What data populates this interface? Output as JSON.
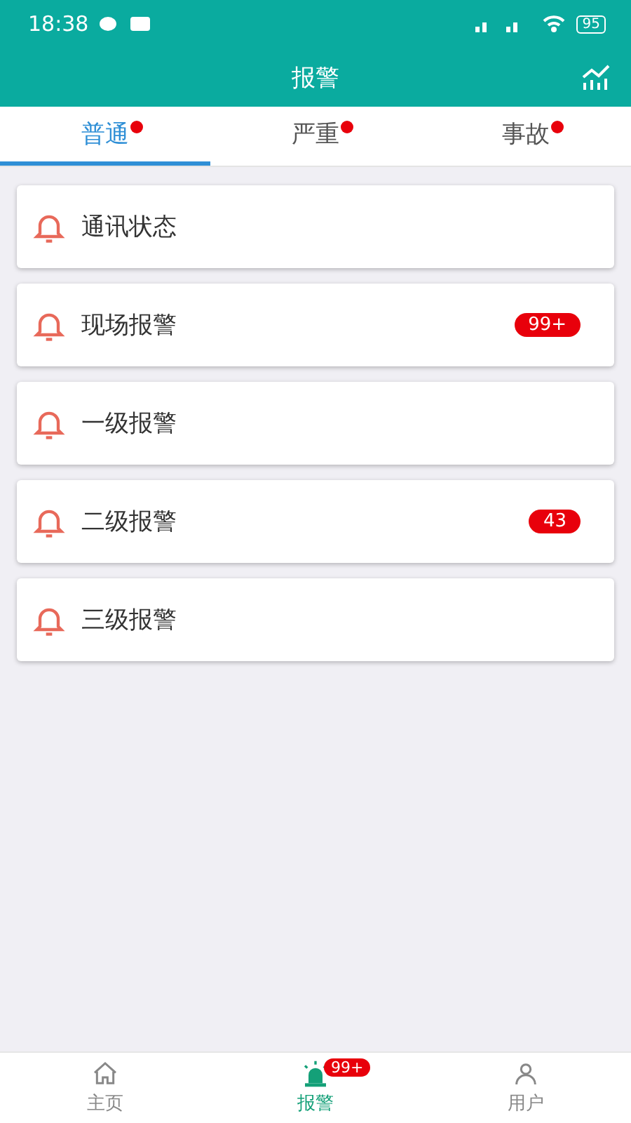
{
  "status_bar": {
    "time": "18:38",
    "battery": "95"
  },
  "header": {
    "title": "报警"
  },
  "tabs": [
    {
      "label": "普通",
      "selected": true,
      "dot": true
    },
    {
      "label": "严重",
      "selected": false,
      "dot": true
    },
    {
      "label": "事故",
      "selected": false,
      "dot": true
    }
  ],
  "alarms": [
    {
      "label": "通讯状态"
    },
    {
      "label": "现场报警",
      "badge": "99+"
    },
    {
      "label": "一级报警"
    },
    {
      "label": "二级报警",
      "badge": "43"
    },
    {
      "label": "三级报警"
    }
  ],
  "bottom_nav": [
    {
      "label": "主页",
      "kind": "home",
      "selected": false
    },
    {
      "label": "报警",
      "kind": "alarm",
      "selected": true,
      "badge": "99+"
    },
    {
      "label": "用户",
      "kind": "user",
      "selected": false
    }
  ]
}
